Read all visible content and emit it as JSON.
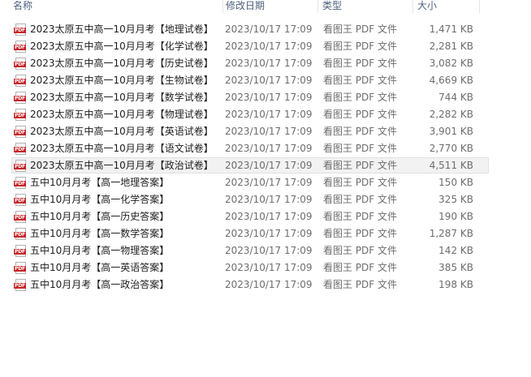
{
  "columns": {
    "name": "名称",
    "date": "修改日期",
    "type": "类型",
    "size": "大小"
  },
  "icon": {
    "file_icon": "pdf-file-icon",
    "badge": "PDF",
    "badge_color": "#c8262a"
  },
  "selected_index": 8,
  "files": [
    {
      "name": "2023太原五中高一10月月考【地理试卷】",
      "date": "2023/10/17 17:09",
      "type": "看图王 PDF 文件",
      "size": "1,471 KB"
    },
    {
      "name": "2023太原五中高一10月月考【化学试卷】",
      "date": "2023/10/17 17:09",
      "type": "看图王 PDF 文件",
      "size": "2,281 KB"
    },
    {
      "name": "2023太原五中高一10月月考【历史试卷】",
      "date": "2023/10/17 17:09",
      "type": "看图王 PDF 文件",
      "size": "3,082 KB"
    },
    {
      "name": "2023太原五中高一10月月考【生物试卷】",
      "date": "2023/10/17 17:09",
      "type": "看图王 PDF 文件",
      "size": "4,669 KB"
    },
    {
      "name": "2023太原五中高一10月月考【数学试卷】",
      "date": "2023/10/17 17:09",
      "type": "看图王 PDF 文件",
      "size": "744 KB"
    },
    {
      "name": "2023太原五中高一10月月考【物理试卷】",
      "date": "2023/10/17 17:09",
      "type": "看图王 PDF 文件",
      "size": "2,282 KB"
    },
    {
      "name": "2023太原五中高一10月月考【英语试卷】",
      "date": "2023/10/17 17:09",
      "type": "看图王 PDF 文件",
      "size": "3,901 KB"
    },
    {
      "name": "2023太原五中高一10月月考【语文试卷】",
      "date": "2023/10/17 17:09",
      "type": "看图王 PDF 文件",
      "size": "2,770 KB"
    },
    {
      "name": "2023太原五中高一10月月考【政治试卷】",
      "date": "2023/10/17 17:09",
      "type": "看图王 PDF 文件",
      "size": "4,511 KB"
    },
    {
      "name": "五中10月月考【高一地理答案】",
      "date": "2023/10/17 17:09",
      "type": "看图王 PDF 文件",
      "size": "150 KB"
    },
    {
      "name": "五中10月月考【高一化学答案】",
      "date": "2023/10/17 17:09",
      "type": "看图王 PDF 文件",
      "size": "325 KB"
    },
    {
      "name": "五中10月月考【高一历史答案】",
      "date": "2023/10/17 17:09",
      "type": "看图王 PDF 文件",
      "size": "190 KB"
    },
    {
      "name": "五中10月月考【高一数学答案】",
      "date": "2023/10/17 17:09",
      "type": "看图王 PDF 文件",
      "size": "1,287 KB"
    },
    {
      "name": "五中10月月考【高一物理答案】",
      "date": "2023/10/17 17:09",
      "type": "看图王 PDF 文件",
      "size": "142 KB"
    },
    {
      "name": "五中10月月考【高一英语答案】",
      "date": "2023/10/17 17:09",
      "type": "看图王 PDF 文件",
      "size": "385 KB"
    },
    {
      "name": "五中10月月考【高一政治答案】",
      "date": "2023/10/17 17:09",
      "type": "看图王 PDF 文件",
      "size": "198 KB"
    }
  ]
}
